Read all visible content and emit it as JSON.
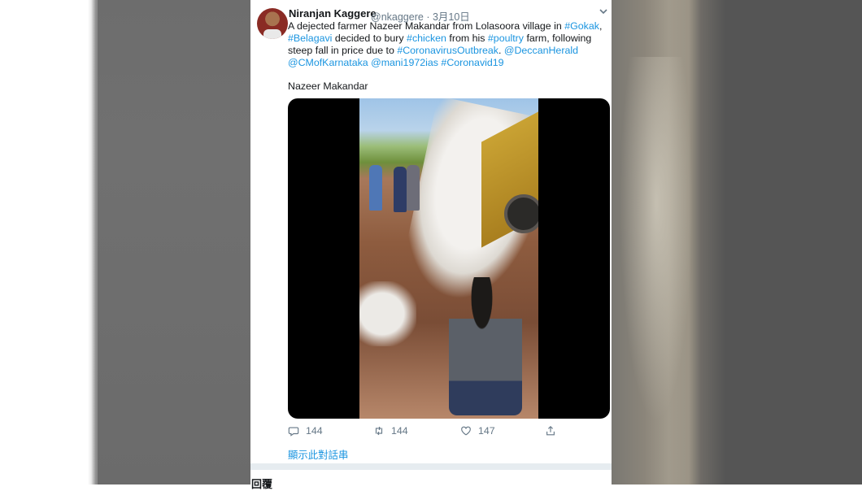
{
  "tweet": {
    "author_name": "Niranjan Kaggere",
    "handle": "@nkaggere",
    "date": "· 3月10日",
    "text_lines": [
      [
        {
          "t": "A dejected farmer Nazeer Makandar from Lolasoora village in ",
          "link": false
        },
        {
          "t": "#Gokak",
          "link": true
        },
        {
          "t": ",",
          "link": false
        }
      ],
      [
        {
          "t": "#Belagavi",
          "link": true
        },
        {
          "t": " decided to bury ",
          "link": false
        },
        {
          "t": "#chicken",
          "link": true
        },
        {
          "t": " from his ",
          "link": false
        },
        {
          "t": "#poultry",
          "link": true
        },
        {
          "t": " farm, following",
          "link": false
        }
      ],
      [
        {
          "t": "steep fall in price due to ",
          "link": false
        },
        {
          "t": "#CoronavirusOutbreak",
          "link": true
        },
        {
          "t": ". ",
          "link": false
        },
        {
          "t": "@DeccanHerald",
          "link": true
        }
      ],
      [
        {
          "t": "@CMofKarnataka",
          "link": true
        },
        {
          "t": " ",
          "link": false
        },
        {
          "t": "@mani1972ias",
          "link": true
        },
        {
          "t": " ",
          "link": false
        },
        {
          "t": "#Coronavid19",
          "link": true
        }
      ]
    ],
    "subline": "Nazeer Makandar",
    "replies": "144",
    "retweets": "144",
    "likes": "147",
    "show_thread": "顯示此對話串"
  },
  "reply_header": "回覆",
  "icons": {
    "reply": "reply-icon",
    "retweet": "retweet-icon",
    "like": "heart-icon",
    "share": "share-icon",
    "more": "chevron-down-icon"
  },
  "colors": {
    "link": "#1b95e0",
    "muted": "#657786",
    "text": "#14171a"
  }
}
